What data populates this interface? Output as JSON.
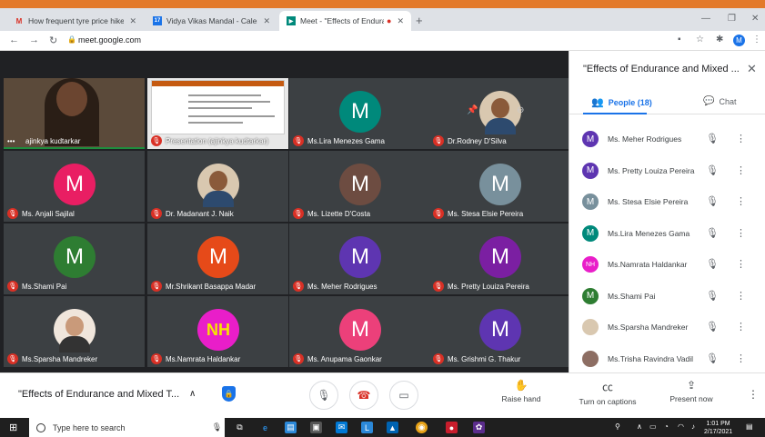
{
  "browser": {
    "tabs": [
      {
        "title": "How frequent tyre price hikes pla",
        "icon": "gmail-icon"
      },
      {
        "title": "Vidya Vikas Mandal - Calendar - ",
        "icon": "calendar-icon"
      },
      {
        "title": "Meet - \"Effects of Endurance",
        "icon": "meet-icon"
      }
    ],
    "url": "meet.google.com",
    "profile_initial": "M"
  },
  "tiles": [
    {
      "name": "ajinkya kudtarkar",
      "kind": "self"
    },
    {
      "name": "Presentation (ajinkya kudtarkar)",
      "kind": "presentation"
    },
    {
      "name": "Ms.Lira Menezes Gama",
      "initial": "M",
      "color": "#00897b",
      "kind": "avatar"
    },
    {
      "name": "Dr.Rodney D'Silva",
      "kind": "photo"
    },
    {
      "name": "Ms. Anjali Sajilal",
      "initial": "M",
      "color": "#e91e63",
      "kind": "avatar"
    },
    {
      "name": "Dr. Madanant J. Naik",
      "kind": "photo"
    },
    {
      "name": "Ms. Lizette D'Costa",
      "initial": "M",
      "color": "#6d4c41",
      "kind": "avatar"
    },
    {
      "name": "Ms. Stesa Elsie Pereira",
      "initial": "M",
      "color": "#78909c",
      "kind": "avatar"
    },
    {
      "name": "Ms.Shami Pai",
      "initial": "M",
      "color": "#2e7d32",
      "kind": "avatar"
    },
    {
      "name": "Mr.Shrikant Basappa Madar",
      "initial": "M",
      "color": "#e64a19",
      "kind": "avatar"
    },
    {
      "name": "Ms. Meher Rodrigues",
      "initial": "M",
      "color": "#5e35b1",
      "kind": "avatar"
    },
    {
      "name": "Ms. Pretty Louiza Pereira",
      "initial": "M",
      "color": "#7b1fa2",
      "kind": "avatar"
    },
    {
      "name": "Ms.Sparsha Mandreker",
      "kind": "photo"
    },
    {
      "name": "Ms.Namrata Haldankar",
      "initial": "NH",
      "color": "#e91ec9",
      "kind": "avatar"
    },
    {
      "name": "Ms. Anupama Gaonkar",
      "initial": "M",
      "color": "#ec407a",
      "kind": "avatar"
    },
    {
      "name": "Ms. Grishmi G. Thakur",
      "initial": "M",
      "color": "#5e35b1",
      "kind": "avatar"
    }
  ],
  "panel": {
    "title": "\"Effects of Endurance and Mixed ...",
    "people_tab": "People (18)",
    "chat_tab": "Chat",
    "people": [
      {
        "name": "Ms. Meher Rodrigues",
        "initial": "M",
        "color": "#5e35b1"
      },
      {
        "name": "Ms. Pretty Louiza Pereira",
        "initial": "M",
        "color": "#5e35b1"
      },
      {
        "name": "Ms. Stesa Elsie Pereira",
        "initial": "M",
        "color": "#78909c"
      },
      {
        "name": "Ms.Lira Menezes Gama",
        "initial": "M",
        "color": "#00897b"
      },
      {
        "name": "Ms.Namrata Haldankar",
        "initial": "NH",
        "color": "#e91ec9"
      },
      {
        "name": "Ms.Shami Pai",
        "initial": "M",
        "color": "#2e7d32"
      },
      {
        "name": "Ms.Sparsha Mandreker",
        "initial": "",
        "color": "#d9c8b0"
      },
      {
        "name": "Ms.Trisha Ravindra Vadil",
        "initial": "",
        "color": "#8d6e63"
      }
    ]
  },
  "bottom": {
    "meeting_title": "\"Effects of Endurance and Mixed T...",
    "raise_hand": "Raise hand",
    "captions": "Turn on captions",
    "present": "Present now"
  },
  "taskbar": {
    "search_placeholder": "Type here to search",
    "time": "1:01 PM",
    "date": "2/17/2021"
  }
}
